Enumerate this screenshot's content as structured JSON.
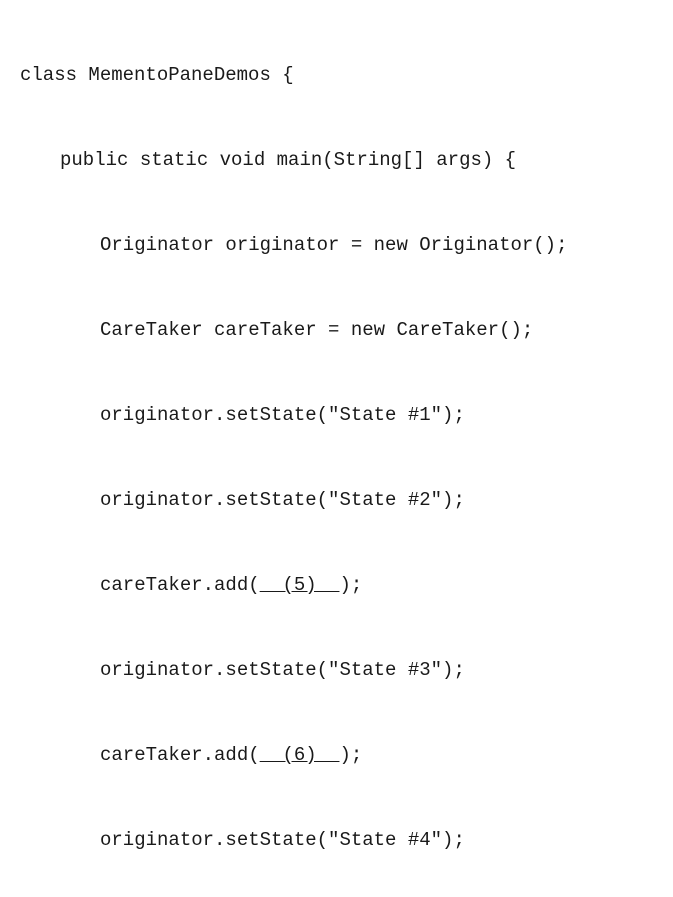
{
  "code": {
    "line1": "class MementoPaneDemos {",
    "line2": "public static void main(String[] args) {",
    "line3": "Originator originator = new Originator();",
    "line4": "CareTaker careTaker = new CareTaker();",
    "line5": "originator.setState(\"State #1\");",
    "line6": "originator.setState(\"State #2\");",
    "line7_prefix": "careTaker.add(",
    "line7_blank": "  (5)  ",
    "line7_suffix": ");",
    "line8": "originator.setState(\"State #3\");",
    "line9_prefix": "careTaker.add(",
    "line9_blank": "  (6)  ",
    "line9_suffix": ");",
    "line10": "originator.setState(\"State #4\");"
  }
}
